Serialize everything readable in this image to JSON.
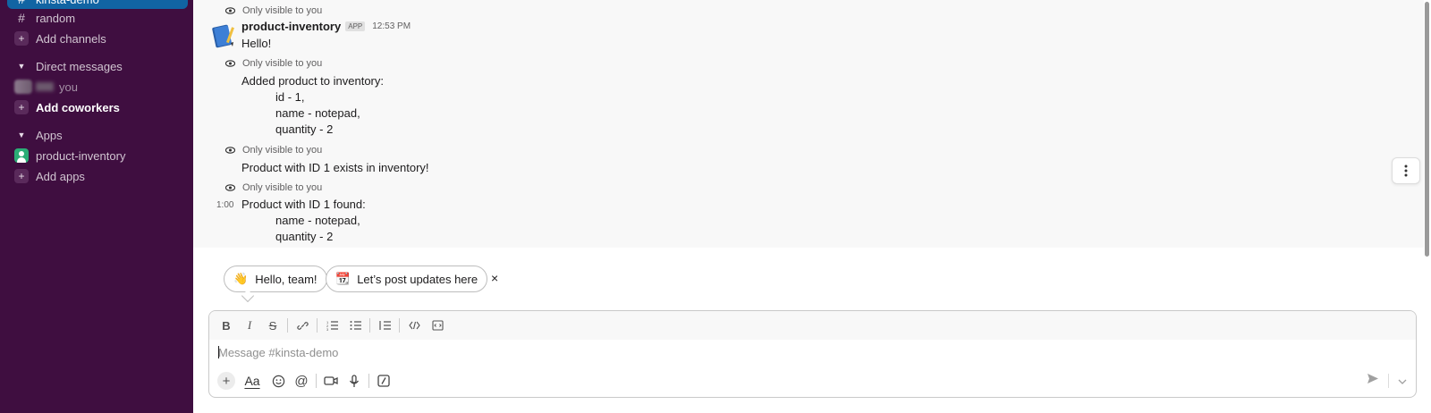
{
  "sidebar": {
    "active_channel": "kinsta-demo",
    "channels": [
      {
        "label": "random"
      }
    ],
    "add_channels": "Add channels",
    "dm_section": "Direct messages",
    "dm_self_suffix": "you",
    "add_coworkers": "Add coworkers",
    "apps_section": "Apps",
    "apps": [
      {
        "label": "product-inventory"
      }
    ],
    "add_apps": "Add apps"
  },
  "messages": {
    "ephemeral_label": "Only visible to you",
    "sender": "product-inventory",
    "badge": "APP",
    "timestamp": "12:53 PM",
    "hover_time": "1:00",
    "hello": "Hello!",
    "added_title": "Added product to inventory:",
    "added_lines": [
      "id - 1,",
      "name - notepad,",
      "quantity - 2"
    ],
    "exists": "Product with ID 1 exists in inventory!",
    "found_title": "Product with ID 1 found:",
    "found_lines": [
      "name - notepad,",
      "quantity - 2"
    ]
  },
  "suggestions": [
    {
      "icon": "👋",
      "label": "Hello, team!"
    },
    {
      "icon": "📆",
      "label": "Let’s post updates here"
    }
  ],
  "suggestions_close": "×",
  "composer": {
    "placeholder": "Message #kinsta-demo",
    "value": "",
    "aa": "Aa"
  },
  "colors": {
    "sidebar_bg": "#3f0e40",
    "active_channel_bg": "#1164a3",
    "message_area_bg": "#f8f8f8",
    "app_avatar": "#2bac76"
  }
}
